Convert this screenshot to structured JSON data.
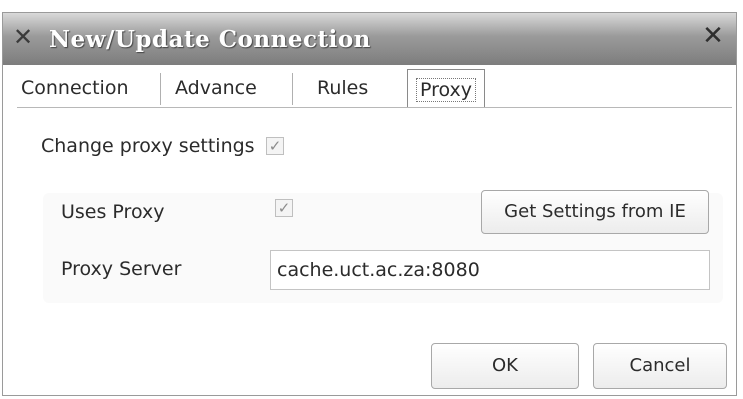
{
  "window": {
    "title": "New/Update Connection",
    "icon": "connection-icon",
    "close_icon": "close-icon"
  },
  "tabs": [
    {
      "label": "Connection",
      "active": false
    },
    {
      "label": "Advance",
      "active": false
    },
    {
      "label": "Rules",
      "active": false
    },
    {
      "label": "Proxy",
      "active": true
    }
  ],
  "proxy": {
    "change_settings_label": "Change proxy settings",
    "change_settings_checked": true,
    "uses_proxy_label": "Uses Proxy",
    "uses_proxy_checked": true,
    "get_settings_button": "Get Settings from IE",
    "server_label": "Proxy Server",
    "server_value": "cache.uct.ac.za:8080"
  },
  "buttons": {
    "ok": "OK",
    "cancel": "Cancel"
  }
}
